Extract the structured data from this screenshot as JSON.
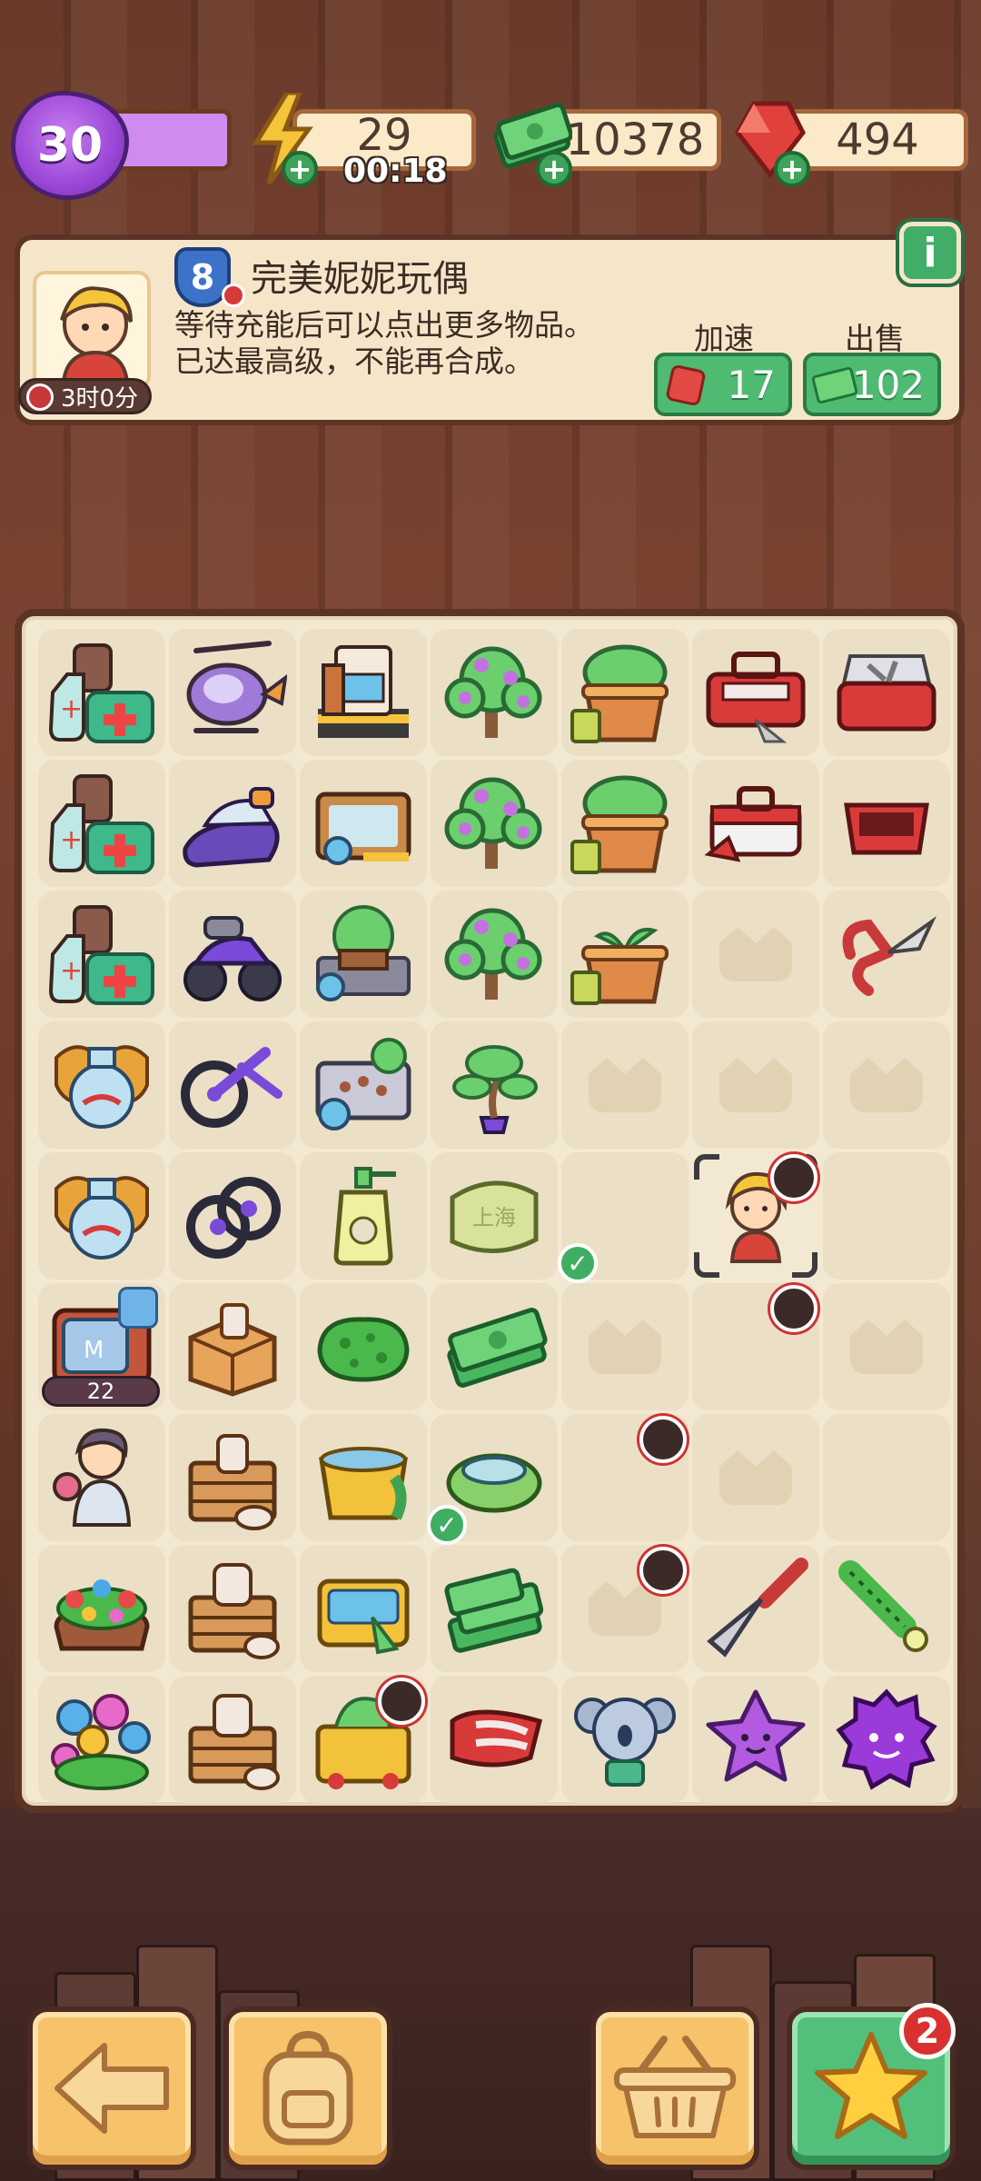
{
  "hud": {
    "level": "30",
    "energy": "29",
    "energy_timer": "00:18",
    "cash": "10378",
    "gems": "494"
  },
  "info": {
    "item_level": "8",
    "item_name": "完美妮妮玩偶",
    "desc_line1": "等待充能后可以点出更多物品。",
    "desc_line2": "已达最高级，不能再合成。",
    "timer": "3时0分",
    "speed_label": "加速",
    "speed_cost": "17",
    "sell_label": "出售",
    "sell_value": "+102"
  },
  "board": {
    "energy_cost": "22",
    "cells": [
      "medicine-kit",
      "helicopter-toy",
      "vending-machine-box",
      "flower-tree",
      "plant-pot",
      "red-toolbox",
      "red-toolbox-open",
      "medicine-kit",
      "jet-ski-toy",
      "sandbox",
      "flower-tree",
      "plant-pot",
      "red-toolbox-small",
      "red-tray",
      "medicine-kit",
      "motorbike-toy",
      "park-bench-box",
      "flower-tree",
      "sprout-pot",
      "empty",
      "pruning-shears",
      "dragon-vase",
      "bike-wheels",
      "paw-board",
      "bonsai",
      "empty",
      "empty",
      "empty",
      "dragon-vase",
      "wheels",
      "lotion-bottle",
      "shanghai-soap",
      "blank",
      "doll-selected",
      "blank",
      "tv-generator",
      "cardboard-box",
      "green-sponge",
      "cash-stack",
      "empty",
      "blank",
      "empty",
      "grandma-character",
      "wooden-crate",
      "yellow-basin",
      "teal-bowl",
      "blank",
      "empty",
      "blank",
      "flower-bed",
      "pottery-crate",
      "yellow-tub",
      "cash-pile",
      "empty",
      "trowel",
      "green-brush",
      "flower-bouquet",
      "pottery-crate",
      "washing-machine",
      "red-glove",
      "koala-toy",
      "purple-star",
      "purple-blob"
    ]
  },
  "nav": {
    "quest_badge": "2"
  }
}
